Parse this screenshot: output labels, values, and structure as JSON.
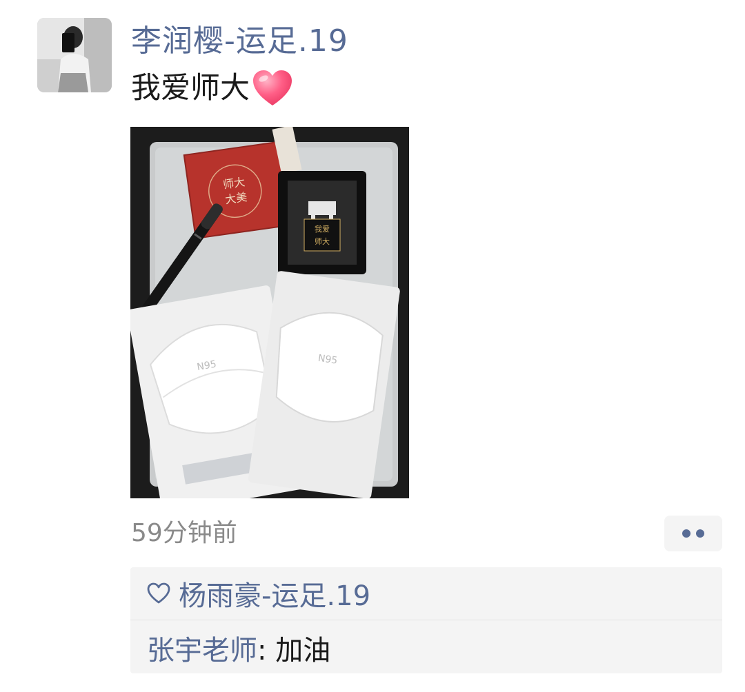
{
  "post": {
    "author": "李润樱-运足.19",
    "text": "我爱师大",
    "text_emoji": "heart-icon",
    "time": "59分钟前",
    "more_icon": "more-dots-icon"
  },
  "photo": {
    "box_text_1": "师大",
    "box_text_2": "大美",
    "frame_text_1": "我爱",
    "frame_text_2": "师大",
    "mask_label": "N95"
  },
  "likes": {
    "icon": "heart-outline-icon",
    "names": "杨雨豪-运足.19"
  },
  "comments": [
    {
      "author": "张宇老师",
      "separator": ": ",
      "text": "加油"
    }
  ],
  "colors": {
    "link": "#576b95",
    "text": "#1a1a1a",
    "muted": "#8a8a8a",
    "panel": "#f4f4f4"
  }
}
